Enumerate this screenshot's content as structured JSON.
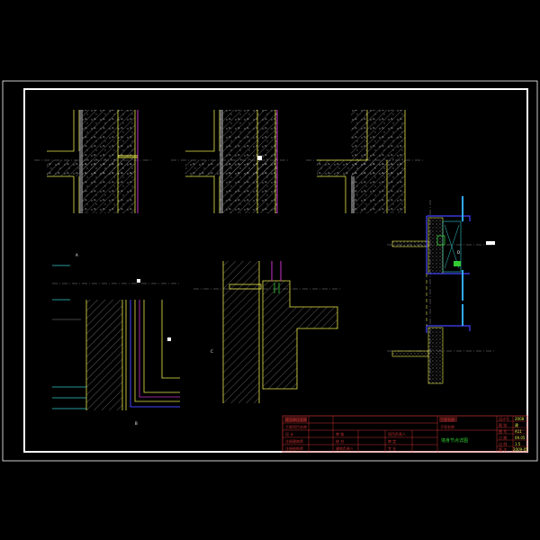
{
  "title_block": {
    "left_rows": [
      {
        "label": "建设单位名称",
        "value": ""
      },
      {
        "label": "工程项目名称",
        "value": ""
      },
      {
        "label": "设 计",
        "value": "审 核"
      },
      {
        "label": "注册建筑师",
        "value": "校 对"
      },
      {
        "label": "注册结构师",
        "value": "建筑负责人"
      }
    ],
    "mid_labels": [
      "项目负责人",
      "审 定",
      "专 业"
    ],
    "project_labels": [
      "工程名称",
      "子项名称"
    ],
    "drawing_title": "墙身节点详图",
    "right_labels": [
      "设计号",
      "图 别",
      "图 号",
      "日 期",
      "比 例",
      "版 次"
    ],
    "right_values": [
      "2008",
      "建",
      "A11",
      "09.05",
      "1:5",
      "2009-05"
    ]
  },
  "annotations": {
    "note_a": "A",
    "note_b": "B",
    "note_c": "C",
    "note_d": "D"
  },
  "colors": {
    "frame": "#ffffff",
    "wall_outline": "#e8e84a",
    "hatch": "#b8b8b8",
    "membrane": "#cc33cc",
    "glass": "#33aaff",
    "blue_line": "#4444ff",
    "dim_cyan": "#33cccc",
    "title_red": "#cc3333",
    "title_green": "#33cc33"
  }
}
